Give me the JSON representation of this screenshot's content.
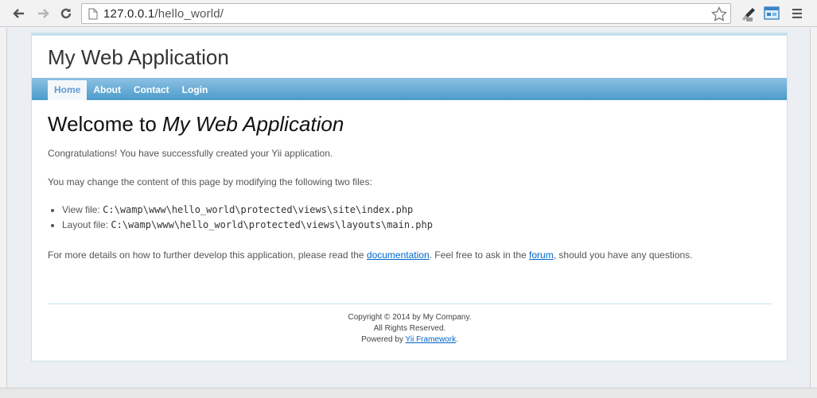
{
  "browser": {
    "url_host": "127.0.0.1",
    "url_path": "/hello_world/"
  },
  "app": {
    "title": "My Web Application"
  },
  "menu": {
    "items": [
      {
        "label": "Home"
      },
      {
        "label": "About"
      },
      {
        "label": "Contact"
      },
      {
        "label": "Login"
      }
    ]
  },
  "content": {
    "heading_prefix": "Welcome to ",
    "heading_app": "My Web Application",
    "congrats": "Congratulations! You have successfully created your Yii application.",
    "intro": "You may change the content of this page by modifying the following two files:",
    "files": [
      {
        "label": "View file: ",
        "path": "C:\\wamp\\www\\hello_world\\protected\\views\\site\\index.php"
      },
      {
        "label": "Layout file: ",
        "path": "C:\\wamp\\www\\hello_world\\protected\\views\\layouts\\main.php"
      }
    ],
    "more_prefix": "For more details on how to further develop this application, please read the ",
    "doc_link": "documentation",
    "more_middle": ". Feel free to ask in the ",
    "forum_link": "forum",
    "more_suffix": ", should you have any questions."
  },
  "footer": {
    "copyright": "Copyright © 2014 by My Company.",
    "rights": "All Rights Reserved.",
    "powered_prefix": "Powered by ",
    "powered_link": "Yii Framework",
    "powered_suffix": "."
  }
}
